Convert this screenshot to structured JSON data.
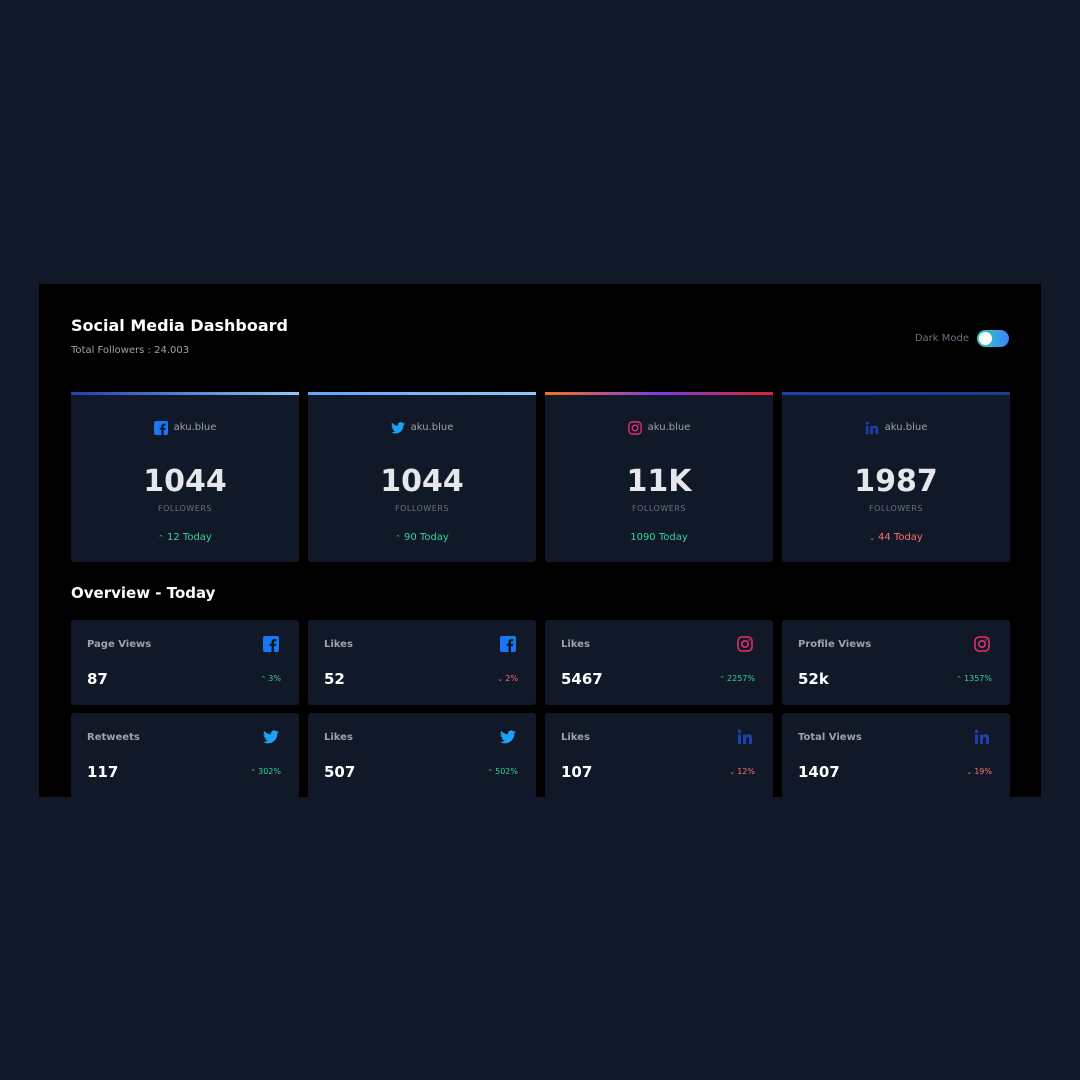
{
  "header": {
    "title": "Social Media Dashboard",
    "total_followers": "Total Followers : 24.003",
    "mode_label": "Dark Mode"
  },
  "colors": {
    "facebook": "#1877f2",
    "twitter": "#1da1f2",
    "instagram": "#e1306c",
    "linkedin": "#1e40af",
    "up": "#34d399",
    "down": "#f87171"
  },
  "cards": [
    {
      "network": "facebook",
      "icon": "facebook-icon",
      "handle": "aku.blue",
      "count": "1044",
      "label": "FOLLOWERS",
      "today": "12 Today",
      "trend": "up"
    },
    {
      "network": "twitter",
      "icon": "twitter-icon",
      "handle": "aku.blue",
      "count": "1044",
      "label": "FOLLOWERS",
      "today": "90 Today",
      "trend": "up"
    },
    {
      "network": "instagram",
      "icon": "instagram-icon",
      "handle": "aku.blue",
      "count": "11K",
      "label": "FOLLOWERS",
      "today": "1090 Today",
      "trend": "none"
    },
    {
      "network": "linkedin",
      "icon": "linkedin-icon",
      "handle": "aku.blue",
      "count": "1987",
      "label": "FOLLOWERS",
      "today": "44 Today",
      "trend": "down"
    }
  ],
  "overview": {
    "title": "Overview - Today",
    "stats": [
      {
        "label": "Page Views",
        "icon": "facebook-icon",
        "value": "87",
        "change": "3%",
        "trend": "up"
      },
      {
        "label": "Likes",
        "icon": "facebook-icon",
        "value": "52",
        "change": "2%",
        "trend": "down"
      },
      {
        "label": "Likes",
        "icon": "instagram-icon",
        "value": "5467",
        "change": "2257%",
        "trend": "up"
      },
      {
        "label": "Profile Views",
        "icon": "instagram-icon",
        "value": "52k",
        "change": "1357%",
        "trend": "up"
      },
      {
        "label": "Retweets",
        "icon": "twitter-icon",
        "value": "117",
        "change": "302%",
        "trend": "up"
      },
      {
        "label": "Likes",
        "icon": "twitter-icon",
        "value": "507",
        "change": "502%",
        "trend": "up"
      },
      {
        "label": "Likes",
        "icon": "linkedin-icon",
        "value": "107",
        "change": "12%",
        "trend": "down"
      },
      {
        "label": "Total Views",
        "icon": "linkedin-icon",
        "value": "1407",
        "change": "19%",
        "trend": "down"
      }
    ]
  }
}
